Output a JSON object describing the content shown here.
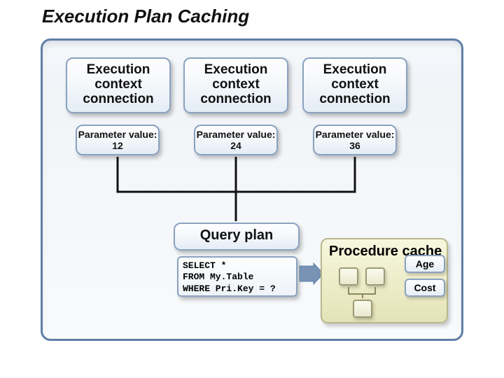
{
  "title": "Execution Plan Caching",
  "contexts": [
    {
      "heading": "Execution context connection",
      "param_label": "Parameter value: 12"
    },
    {
      "heading": "Execution context connection",
      "param_label": "Parameter value: 24"
    },
    {
      "heading": "Execution context connection",
      "param_label": "Parameter value: 36"
    }
  ],
  "query_plan": {
    "title": "Query plan",
    "sql": "SELECT *\nFROM My.Table\nWHERE Pri.Key = ?"
  },
  "procedure_cache": {
    "label": "Procedure cache",
    "badges": [
      "Age",
      "Cost"
    ]
  }
}
